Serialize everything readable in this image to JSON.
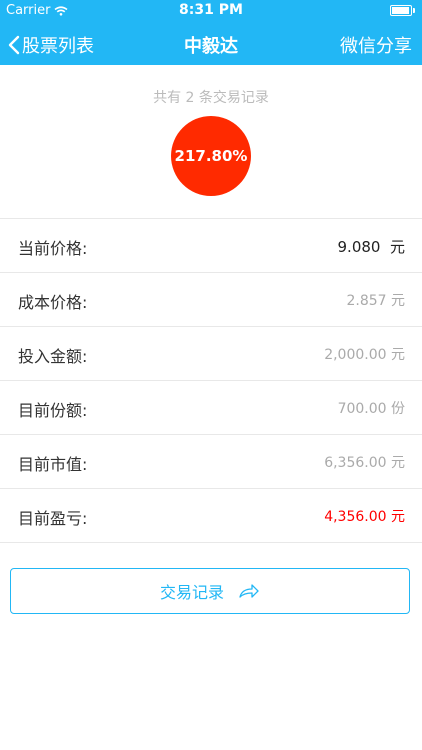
{
  "status_bar": {
    "carrier": "Carrier",
    "time": "8:31 PM"
  },
  "nav": {
    "back_label": "股票列表",
    "title": "中毅达",
    "share_label": "微信分享"
  },
  "summary": {
    "record_count_text": "共有 2 条交易记录",
    "profit_percent": "217.80%"
  },
  "rows": [
    {
      "label": "当前价格:",
      "value": "9.080  元"
    },
    {
      "label": "成本价格:",
      "value": "2.857 元"
    },
    {
      "label": "投入金额:",
      "value": "2,000.00 元"
    },
    {
      "label": "目前份额:",
      "value": "700.00 份"
    },
    {
      "label": "目前市值:",
      "value": "6,356.00 元"
    },
    {
      "label": "目前盈亏:",
      "value": "4,356.00 元"
    }
  ],
  "trade_button": {
    "label": "交易记录"
  },
  "colors": {
    "accent": "#22b7f5",
    "profit_red": "#ff2a00"
  }
}
